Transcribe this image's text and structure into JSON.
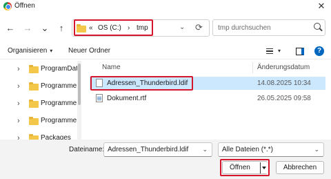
{
  "window": {
    "title": "Öffnen",
    "close_glyph": "✕"
  },
  "nav": {
    "back": "←",
    "forward": "→",
    "recent": "⌄",
    "up": "↑"
  },
  "address": {
    "crumbs": [
      "«",
      "OS (C:)",
      "›",
      "tmp"
    ],
    "dropdown_glyph": "⌄",
    "refresh_glyph": "⟳"
  },
  "search": {
    "placeholder": "tmp durchsuchen"
  },
  "toolbar": {
    "organize": "Organisieren",
    "organize_caret": "▾",
    "new_folder": "Neuer Ordner",
    "view_caret": "▾",
    "help": "?"
  },
  "sidebar": {
    "items": [
      {
        "label": "ProgramData",
        "chevron": "›"
      },
      {
        "label": "Programme",
        "chevron": "›"
      },
      {
        "label": "Programme",
        "chevron": "›"
      },
      {
        "label": "Programme",
        "chevron": "›"
      },
      {
        "label": "Packages",
        "chevron": "›"
      }
    ]
  },
  "filelist": {
    "columns": {
      "name": "Name",
      "modified": "Änderungsdatum"
    },
    "files": [
      {
        "name": "Adressen_Thunderbird.ldif",
        "modified": "14.08.2025 10:34",
        "selected": true
      },
      {
        "name": "Dokument.rtf",
        "modified": "26.05.2025 09:58",
        "selected": false
      }
    ]
  },
  "footer": {
    "filename_label": "Dateiname:",
    "filename_value": "Adressen_Thunderbird.ldif",
    "filename_caret": "⌄",
    "filetype_value": "Alle Dateien (*.*)",
    "filetype_caret": "⌄",
    "open_label": "Öffnen",
    "cancel_label": "Abbrechen"
  },
  "colors": {
    "accent": "#0067c0",
    "highlight": "#d6162c",
    "selection": "#cce8ff",
    "folder": "#f3c84a"
  }
}
